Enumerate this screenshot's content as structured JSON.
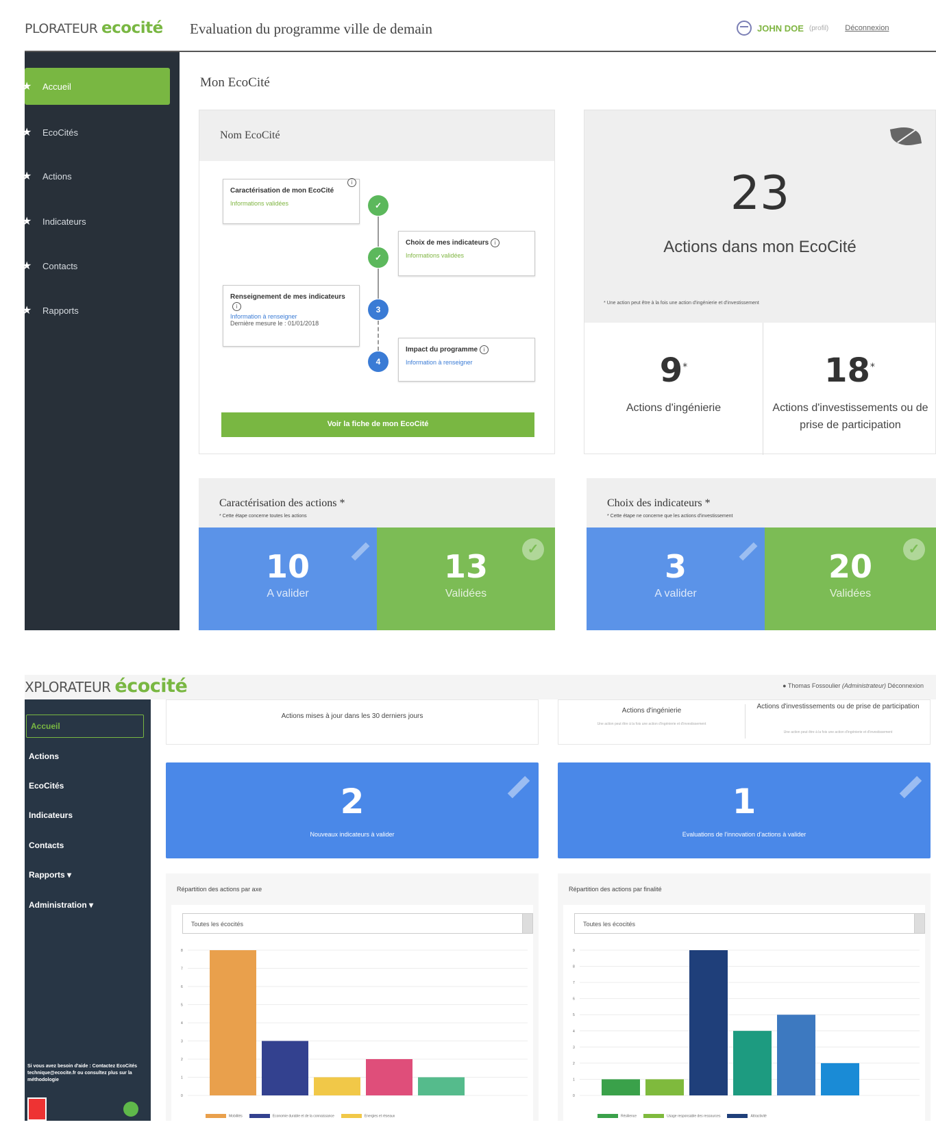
{
  "screen1": {
    "logo_prefix": "PLORATEUR",
    "logo_eco": "ecocité",
    "title": "Evaluation du programme ville de demain",
    "user_name": "JOHN DOE",
    "user_role": "(profil)",
    "logout": "Déconnexion",
    "nav": [
      "Accueil",
      "EcoCités",
      "Actions",
      "Indicateurs",
      "Contacts",
      "Rapports"
    ],
    "section_title": "Mon EcoCité",
    "card_title": "Nom EcoCité",
    "steps": [
      {
        "title": "Caractérisation de mon EcoCité",
        "status": "Informations validées"
      },
      {
        "title": "Choix de mes indicateurs",
        "status": "Informations validées"
      },
      {
        "title": "Renseignement de mes indicateurs",
        "status": "Information à renseigner",
        "date": "Dernière mesure le : 01/01/2018"
      },
      {
        "title": "Impact du programme",
        "status": "Information à renseigner"
      }
    ],
    "step_numbers": [
      "3",
      "4"
    ],
    "fiche_button": "Voir la fiche de mon EcoCité",
    "total_actions": "23",
    "total_label": "Actions dans mon EcoCité",
    "total_note": "* Une action peut être à la fois une action d'ingénierie et d'investissement",
    "ing_value": "9",
    "ing_label": "Actions d'ingénierie",
    "inv_value": "18",
    "inv_label": "Actions d'investissements ou de prise de participation",
    "caract_title": "Caractérisation des actions *",
    "caract_note": "* Cette étape concerne toutes les actions",
    "caract_todo": "10",
    "caract_done": "13",
    "choix_title": "Choix des indicateurs *",
    "choix_note": "* Cette étape ne concerne que les actions d'investissement",
    "choix_todo": "3",
    "choix_done": "20",
    "to_validate": "A valider",
    "validated": "Validées"
  },
  "screen2": {
    "logo_prefix": "XPLORATEUR",
    "logo_eco": "écocité",
    "user_name": "Thomas Fossoulier",
    "user_role": "(Administrateur)",
    "logout": "Déconnexion",
    "nav": [
      "Accueil",
      "Actions",
      "EcoCités",
      "Indicateurs",
      "Contacts",
      "Rapports ▾",
      "Administration ▾"
    ],
    "help": "Si vous avez besoin d'aide : Contactez EcoCités technique@ecocite.fr ou consultez plus sur la méthodologie",
    "updated_label": "Actions mises à jour dans les 30 derniers jours",
    "ing_label": "Actions d'ingénierie",
    "ing_note": "Une action peut être à la fois une action d'ingénierie et d'investissement",
    "inv_label": "Actions d'investissements ou de prise de participation",
    "inv_note": "Une action peut être à la fois une action d'ingénierie et d'investissement",
    "new_ind_value": "2",
    "new_ind_label": "Nouveaux indicateurs à valider",
    "eval_value": "1",
    "eval_label": "Evaluations de l'innovation d'actions à valider",
    "chart1_title": "Répartition des actions par axe",
    "chart2_title": "Répartition des actions par finalité",
    "select_value": "Toutes les écocités"
  },
  "chart_data": [
    {
      "type": "bar",
      "title": "Répartition des actions par axe",
      "categories": [
        "Mobilités",
        "Economie durable et de la connaissance",
        "Energies et réseaux",
        "",
        ""
      ],
      "values": [
        8,
        3,
        1,
        2,
        1
      ],
      "ylim": [
        0,
        8
      ],
      "colors": [
        "#e9a04c",
        "#33418f",
        "#f1c848",
        "#df4e7a",
        "#55bb8c"
      ],
      "legend": [
        "Mobilités",
        "Economie durable et de la connaissance",
        "Energies et réseaux"
      ]
    },
    {
      "type": "bar",
      "title": "Répartition des actions par finalité",
      "categories": [
        "Résilience",
        "Usage responsable des ressources",
        "Attractivité",
        "",
        "",
        ""
      ],
      "values": [
        1,
        1,
        9,
        4,
        5,
        2
      ],
      "ylim": [
        0,
        9
      ],
      "colors": [
        "#3aa14a",
        "#7fba3d",
        "#1f3f7a",
        "#1d9b80",
        "#3d79c0",
        "#1a8bd6"
      ],
      "legend": [
        "Résilience",
        "Usage responsable des ressources",
        "Attractivité"
      ]
    }
  ]
}
